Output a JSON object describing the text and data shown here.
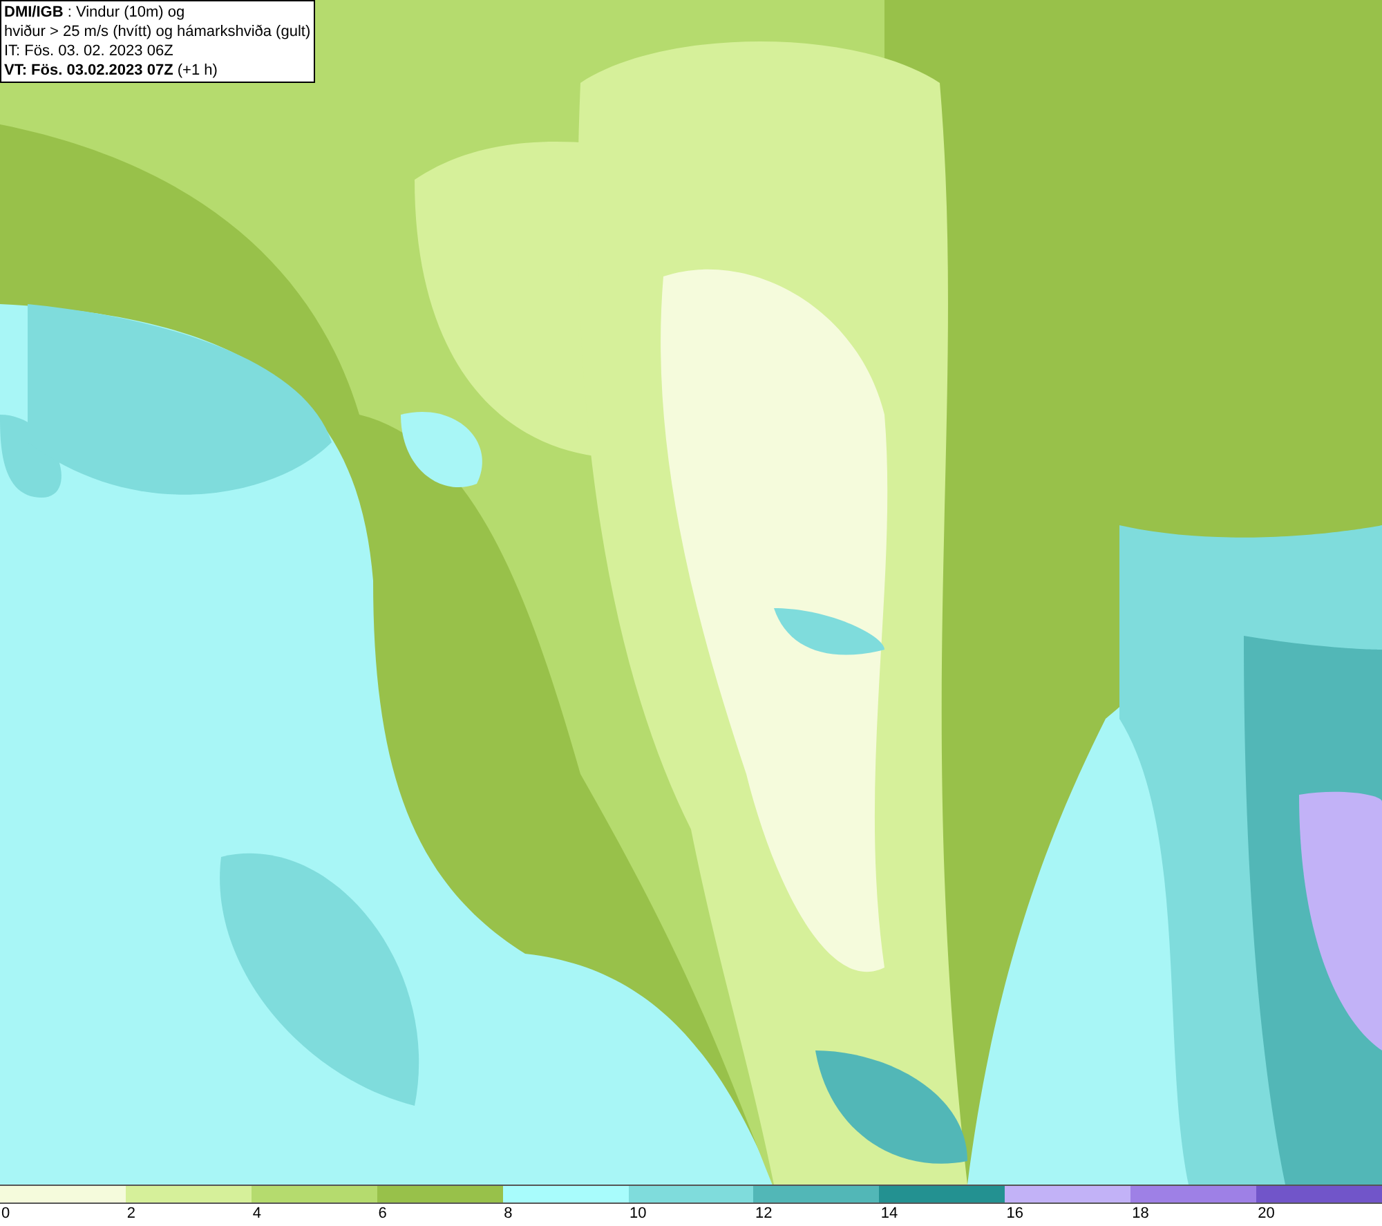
{
  "header": {
    "lines": [
      "**DMI/IGB** : Vindur (10m) og",
      "hviður > 25 m/s (hvítt) og hámarkshviða (gult)",
      "IT: Fös. 03. 02. 2023 06Z",
      "**VT: Fös. 03.02.2023 07Z** (+1 h)"
    ]
  },
  "legend": {
    "segments": [
      {
        "color": "#f5fbdc"
      },
      {
        "color": "#d6f09a"
      },
      {
        "color": "#b5db6e"
      },
      {
        "color": "#98c14a"
      },
      {
        "color": "#a8fcfc"
      },
      {
        "color": "#7fdcdc"
      },
      {
        "color": "#52b7b7"
      },
      {
        "color": "#239191"
      },
      {
        "color": "#c2b2f7"
      },
      {
        "color": "#9e80e6"
      },
      {
        "color": "#7155c9"
      }
    ],
    "labels": [
      "0",
      "2",
      "4",
      "6",
      "8",
      "10",
      "12",
      "14",
      "16",
      "18",
      "20"
    ]
  }
}
